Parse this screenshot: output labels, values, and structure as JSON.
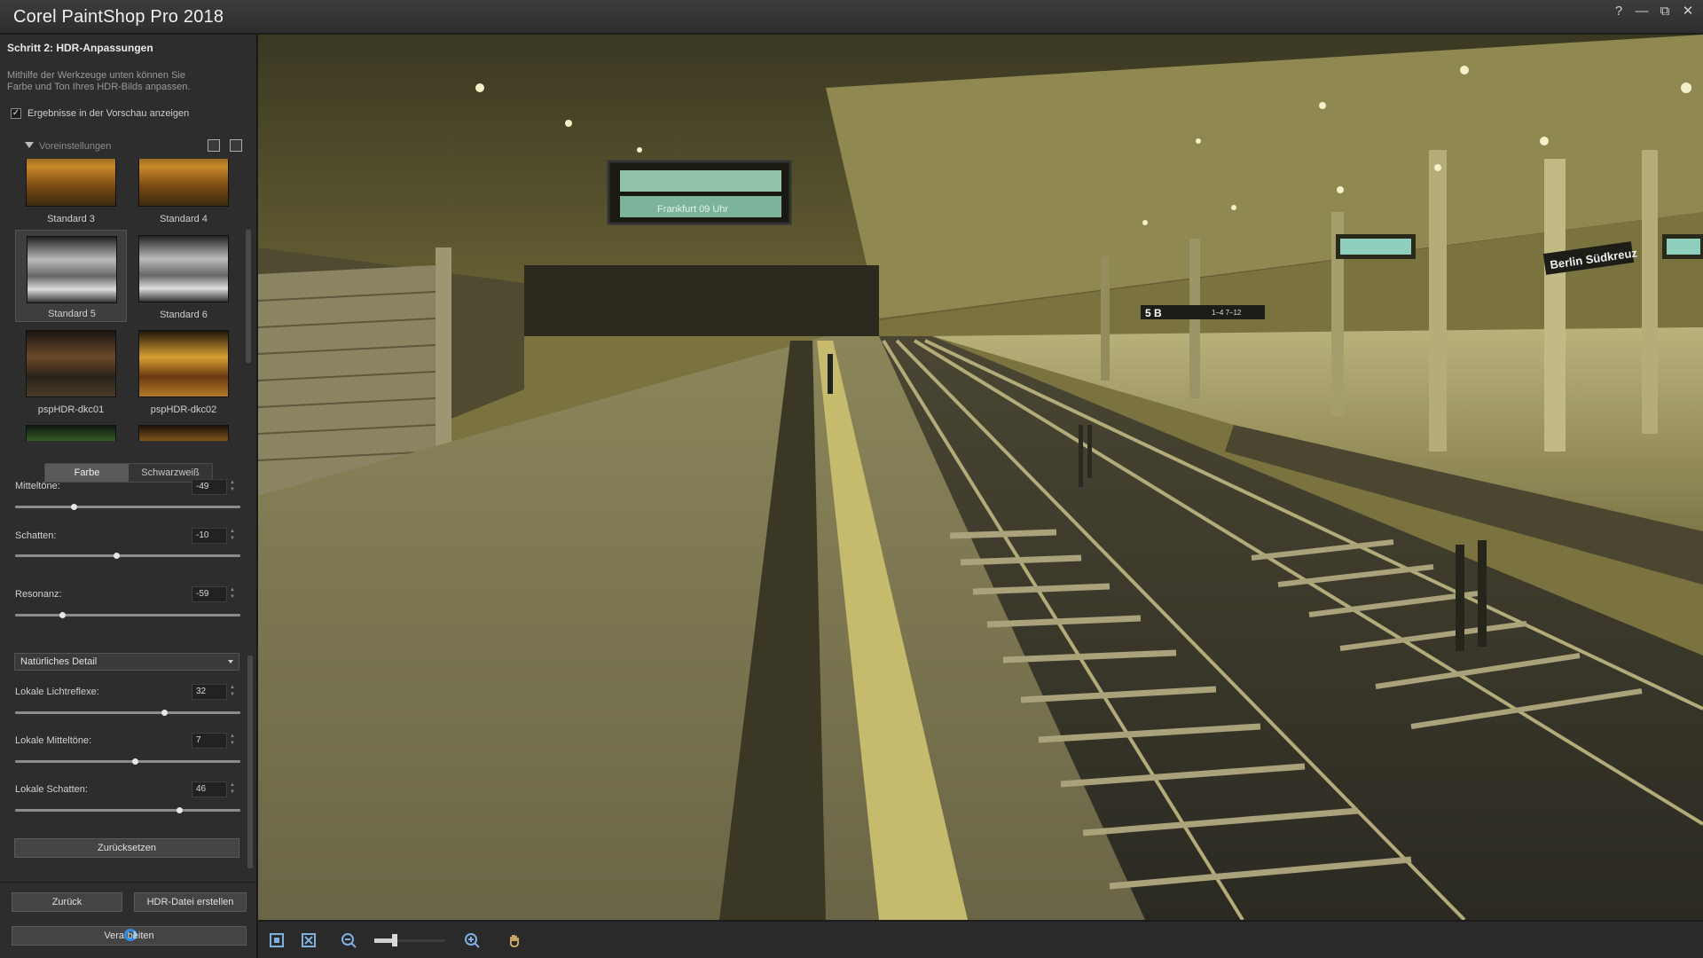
{
  "app": {
    "title": "Corel PaintShop Pro 2018",
    "window_controls": [
      "?",
      "—",
      "⧉",
      "✕"
    ]
  },
  "panel": {
    "step_title": "Schritt 2: HDR-Anpassungen",
    "description": "Mithilfe der Werkzeuge unten können Sie Farbe und Ton Ihres HDR-Bilds anpassen.",
    "preview_checkbox": {
      "label": "Ergebnisse in der Vorschau anzeigen",
      "checked": true
    },
    "presets": {
      "header": "Voreinstellungen",
      "items": [
        {
          "label": "Standard 3",
          "style": "warm"
        },
        {
          "label": "Standard 4",
          "style": "warm"
        },
        {
          "label": "Standard 5",
          "style": "gray",
          "selected": true
        },
        {
          "label": "Standard 6",
          "style": "gray"
        },
        {
          "label": "pspHDR-dkc01",
          "style": "dark"
        },
        {
          "label": "pspHDR-dkc02",
          "style": "gold"
        },
        {
          "label": "",
          "style": "green"
        },
        {
          "label": "",
          "style": "orange"
        }
      ]
    },
    "mode_tabs": {
      "color": "Farbe",
      "bw": "Schwarzweiß",
      "active": "Farbe"
    },
    "sliders_top": [
      {
        "label": "Mitteltöne:",
        "value": "-49",
        "level_pct": 26
      },
      {
        "label": "Schatten:",
        "value": "-10",
        "level_pct": 45
      },
      {
        "label": "Resonanz:",
        "value": "-59",
        "level_pct": 21
      }
    ],
    "detail_select": "Natürliches Detail",
    "sliders_local": [
      {
        "label": "Lokale Lichtreflexe:",
        "value": "32",
        "level_pct": 66
      },
      {
        "label": "Lokale Mitteltöne:",
        "value": "7",
        "level_pct": 53
      },
      {
        "label": "Lokale Schatten:",
        "value": "46",
        "level_pct": 73
      }
    ],
    "reset_button": "Zurücksetzen",
    "back_button": "Zurück",
    "create_hdr_button": "HDR-Datei erstellen",
    "process_button": "Verarbeiten"
  },
  "canvas": {
    "signs": {
      "station_name": "Berlin Südkreuz",
      "platform_board": "Frankfurt 09 Uhr",
      "platform_numbers": "5 B",
      "platform_range": "1–4 7–12"
    }
  },
  "toolbar": {
    "zoom_level_pct": 25
  }
}
